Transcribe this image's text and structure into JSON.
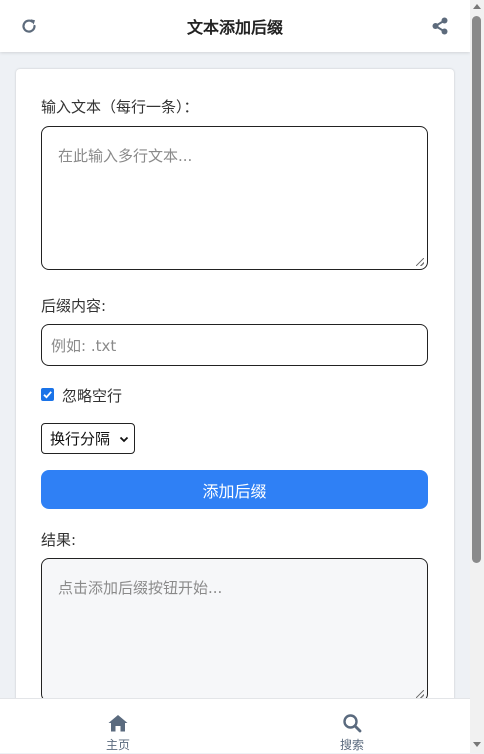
{
  "header": {
    "title": "文本添加后缀"
  },
  "form": {
    "input_label": "输入文本（每行一条）：",
    "input_placeholder": "在此输入多行文本...",
    "suffix_label": "后缀内容:",
    "suffix_placeholder": "例如: .txt",
    "ignore_empty_label": "忽略空行",
    "ignore_empty_checked": true,
    "separator_selected": "换行分隔",
    "add_button_label": "添加后缀",
    "result_label": "结果:",
    "result_placeholder": "点击添加后缀按钮开始..."
  },
  "bottom_nav": {
    "home_label": "主页",
    "search_label": "搜索"
  },
  "colors": {
    "accent": "#2f80f5",
    "nav_text": "#5a6a7e"
  }
}
